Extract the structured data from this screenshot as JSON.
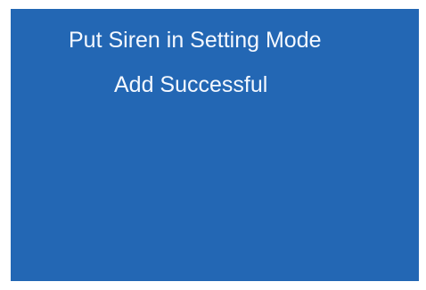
{
  "screen": {
    "line1": "Put Siren in Setting Mode",
    "line2": "Add Successful"
  },
  "colors": {
    "background": "#2367b4",
    "text": "#f4f8ff",
    "page_background": "#ffffff"
  }
}
